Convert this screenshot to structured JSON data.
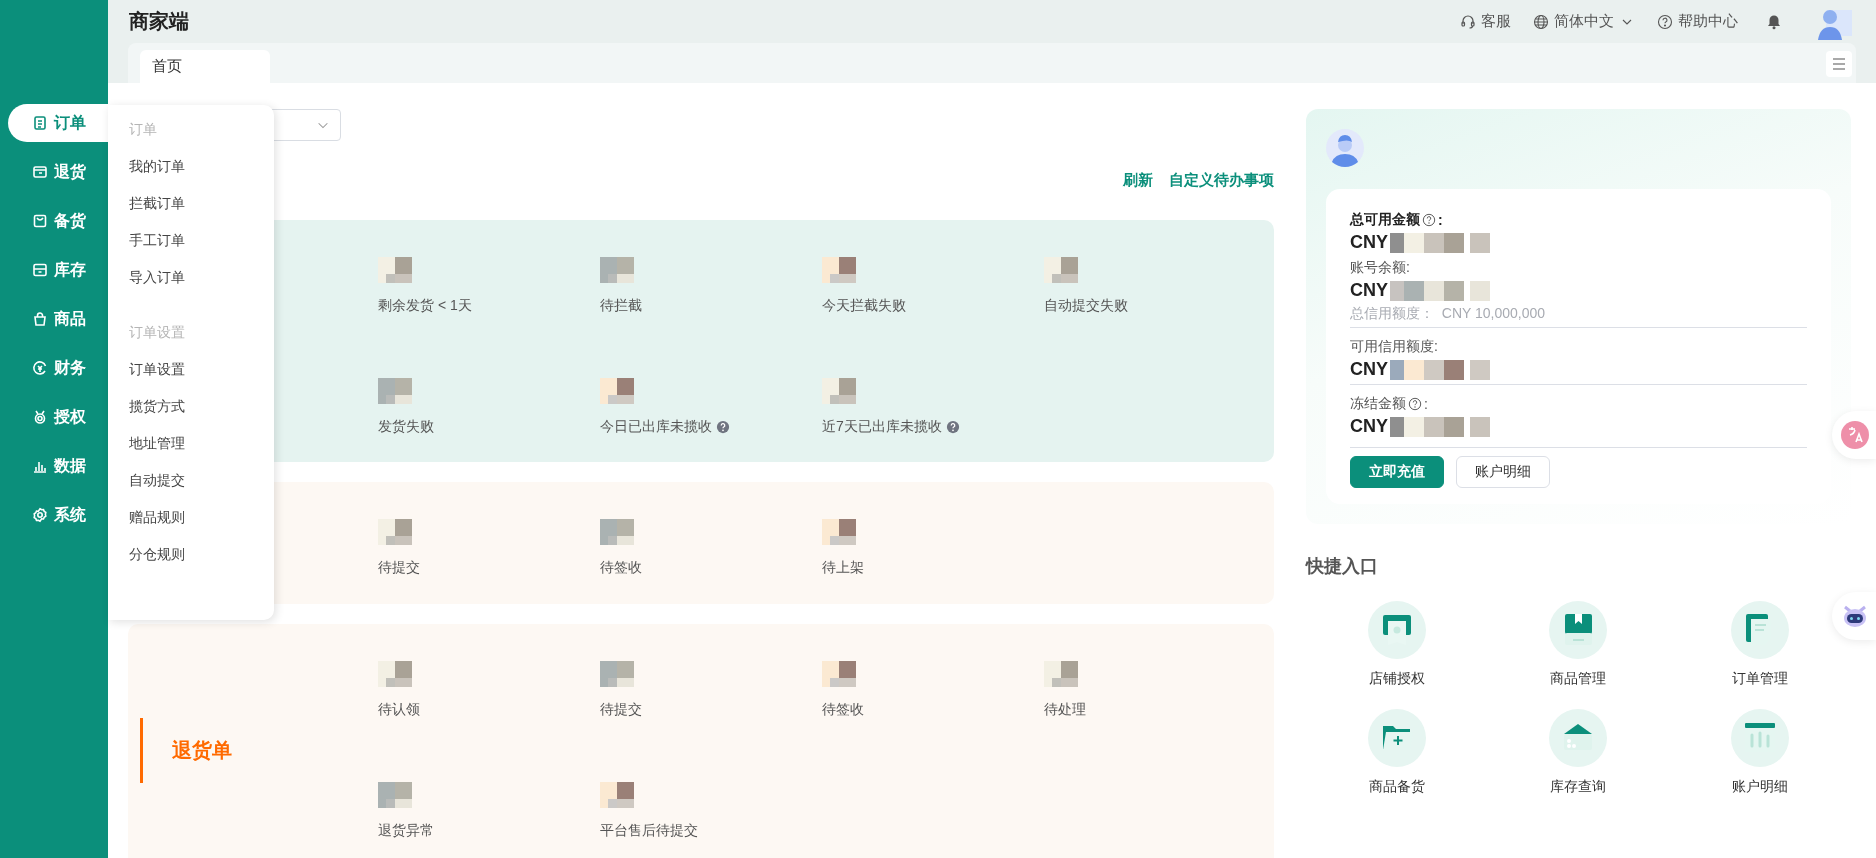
{
  "header": {
    "title": "商家端",
    "links": [
      {
        "kind": "service",
        "label": "客服"
      },
      {
        "kind": "language",
        "label": "简体中文"
      },
      {
        "kind": "help",
        "label": "帮助中心"
      }
    ]
  },
  "tabs": [
    {
      "label": "首页",
      "selected": true
    }
  ],
  "sidebar": {
    "items": [
      {
        "label": "订单",
        "selected": true
      },
      {
        "label": "退货",
        "selected": false
      },
      {
        "label": "备货",
        "selected": false
      },
      {
        "label": "库存",
        "selected": false
      },
      {
        "label": "商品",
        "selected": false
      },
      {
        "label": "财务",
        "selected": false
      },
      {
        "label": "授权",
        "selected": false
      },
      {
        "label": "数据",
        "selected": false
      },
      {
        "label": "系统",
        "selected": false
      }
    ]
  },
  "flyout": {
    "groups": [
      {
        "title": "订单",
        "items": [
          "我的订单",
          "拦截订单",
          "手工订单",
          "导入订单"
        ]
      },
      {
        "title": "订单设置",
        "items": [
          "订单设置",
          "揽货方式",
          "地址管理",
          "自动提交",
          "赠品规则",
          "分仓规则"
        ]
      }
    ]
  },
  "todo": {
    "links": [
      "刷新",
      "自定义待办事项"
    ],
    "sections": [
      {
        "rows": [
          [
            {
              "label": "剩余发货 < 1天",
              "help": false
            },
            {
              "label": "待拦截",
              "help": false
            },
            {
              "label": "今天拦截失败",
              "help": false
            },
            {
              "label": "自动提交失败",
              "help": false
            }
          ],
          [
            {
              "label": "发货失败",
              "help": false
            },
            {
              "label": "今日已出库未揽收",
              "help": true
            },
            {
              "label": "近7天已出库未揽收",
              "help": true
            }
          ]
        ]
      },
      {
        "rows": [
          [
            {
              "label": "待提交",
              "help": false
            },
            {
              "label": "待签收",
              "help": false
            },
            {
              "label": "待上架",
              "help": false
            }
          ]
        ]
      },
      {
        "title": "退货单",
        "rows": [
          [
            {
              "label": "待认领",
              "help": false
            },
            {
              "label": "待提交",
              "help": false
            },
            {
              "label": "待签收",
              "help": false
            },
            {
              "label": "待处理",
              "help": false
            }
          ],
          [
            {
              "label": "退货异常",
              "help": false
            },
            {
              "label": "平台售后待提交",
              "help": false
            }
          ]
        ]
      }
    ]
  },
  "account": {
    "rows": [
      {
        "label": "总可用金额",
        "help": true,
        "suffix": ":",
        "bold": true,
        "currency": "CNY"
      },
      {
        "label": "账号余额:",
        "help": false,
        "bold": false,
        "currency": "CNY",
        "note": "总信用额度：  CNY 10,000,000"
      },
      {
        "label": "可用信用额度:",
        "help": false,
        "bold": false,
        "currency": "CNY"
      },
      {
        "label": "冻结金额",
        "help": true,
        "suffix": ":",
        "bold": false,
        "currency": "CNY"
      }
    ],
    "buttons": [
      {
        "label": "立即充值",
        "primary": true
      },
      {
        "label": "账户明细",
        "primary": false
      }
    ]
  },
  "quick": {
    "title": "快捷入口",
    "items": [
      {
        "label": "店铺授权"
      },
      {
        "label": "商品管理"
      },
      {
        "label": "订单管理"
      },
      {
        "label": "商品备货"
      },
      {
        "label": "库存查询"
      },
      {
        "label": "账户明细"
      }
    ]
  }
}
